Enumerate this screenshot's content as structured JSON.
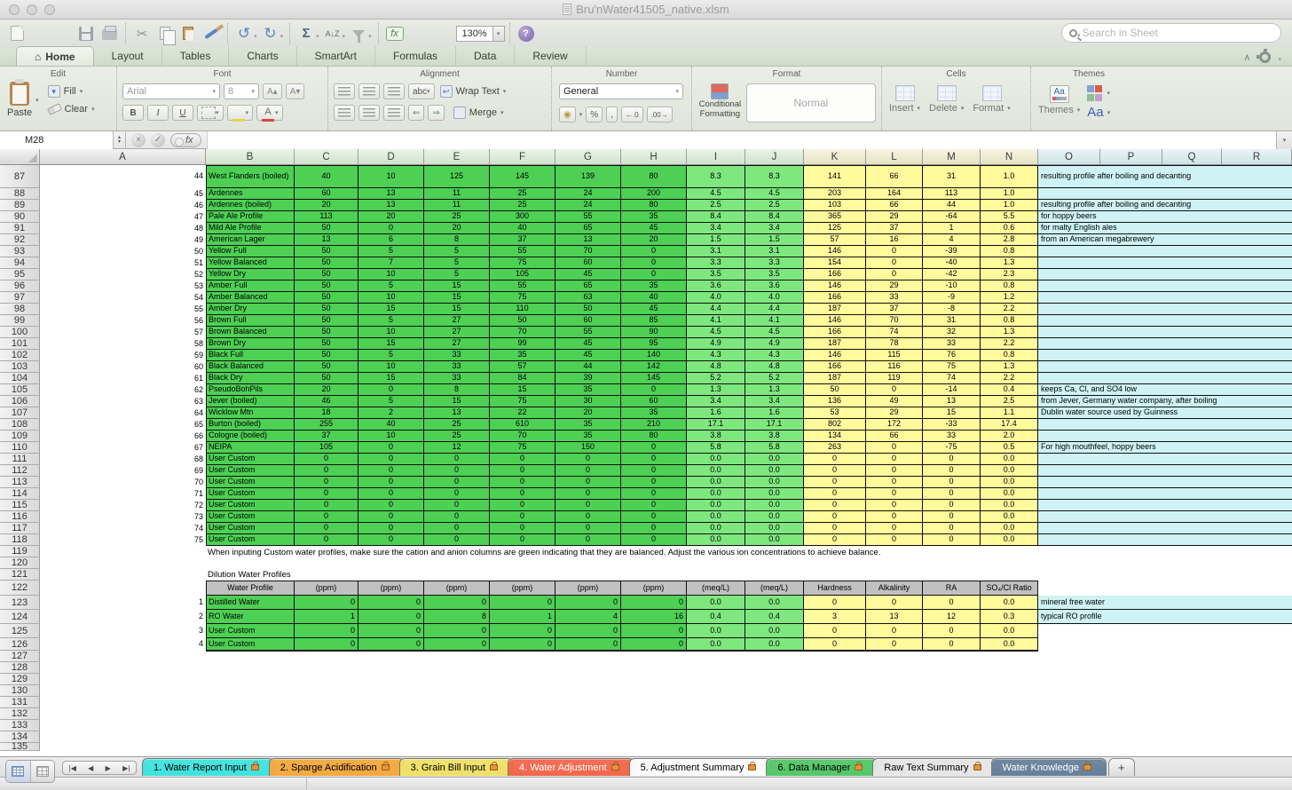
{
  "window": {
    "title": "Bru'nWater41505_native.xlsm"
  },
  "toolbar": {
    "zoom": "130%",
    "search_placeholder": "Search in Sheet",
    "icons": [
      "new-workbook",
      "open",
      "save",
      "print",
      "cut",
      "copy",
      "paste",
      "format-painter",
      "undo",
      "redo",
      "autosum",
      "sort",
      "filter",
      "insert-function",
      "gallery",
      "media-browser",
      "zoom",
      "help"
    ]
  },
  "icons": {
    "home": "⌂",
    "cut": "✂",
    "undo": "↺",
    "redo": "↻",
    "autosum": "Σ",
    "sort": "A↓Z",
    "fx": "fx",
    "percent": "%",
    "comma": ",",
    "dec_left": "←.0",
    "dec_right": ".00→",
    "collapse": "∧",
    "nav_first": "|◀",
    "nav_prev": "◀",
    "nav_next": "▶",
    "nav_last": "▶|",
    "cancel": "×",
    "accept": "✓",
    "stepper_up": "▴",
    "stepper_down": "▾",
    "dropdown": "▾",
    "help": "?",
    "abc": "abc",
    "aa": "Aa"
  },
  "ribbon_tabs": {
    "items": [
      "Home",
      "Layout",
      "Tables",
      "Charts",
      "SmartArt",
      "Formulas",
      "Data",
      "Review"
    ],
    "active": "Home"
  },
  "ribbon": {
    "groups": {
      "edit": "Edit",
      "font": "Font",
      "alignment": "Alignment",
      "number": "Number",
      "format": "Format",
      "cells": "Cells",
      "themes": "Themes"
    },
    "edit": {
      "paste": "Paste",
      "fill": "Fill",
      "clear": "Clear"
    },
    "font": {
      "name": "Arial",
      "size": "8",
      "bold": "B",
      "italic": "I",
      "underline": "U"
    },
    "alignment": {
      "abc": "abc",
      "wrap": "Wrap Text",
      "merge": "Merge"
    },
    "number": {
      "format": "General"
    },
    "format": {
      "conditional": "Conditional Formatting",
      "style": "Normal"
    },
    "cells": {
      "insert": "Insert",
      "delete": "Delete",
      "format": "Format"
    },
    "themes": {
      "themes": "Themes",
      "fonts": "Aa"
    }
  },
  "formula_bar": {
    "name_box": "M28",
    "fx": "fx",
    "value": ""
  },
  "grid": {
    "columns": [
      "A",
      "B",
      "C",
      "D",
      "E",
      "F",
      "G",
      "H",
      "I",
      "J",
      "K",
      "L",
      "M",
      "N",
      "O",
      "P",
      "Q",
      "R"
    ],
    "first_row": 87,
    "last_row": 135
  },
  "colors": {
    "ppm_green": "#4DD054",
    "meq_green": "#7EE87E",
    "stat_yellow": "#FFFA9B",
    "note_cyan": "#CFF2F4",
    "header_gray": "#C1C1C1"
  },
  "main_table": {
    "rows": [
      {
        "row": 87,
        "num": "44",
        "name": "West Flanders (boiled)",
        "ppm": [
          "40",
          "10",
          "125",
          "145",
          "139",
          "80"
        ],
        "meq": [
          "8.3",
          "8.3"
        ],
        "stats": [
          "141",
          "66",
          "31",
          "1.0"
        ],
        "note": "resulting profile after boiling and decanting"
      },
      {
        "row": 88,
        "num": "45",
        "name": "Ardennes",
        "ppm": [
          "60",
          "13",
          "11",
          "25",
          "24",
          "200"
        ],
        "meq": [
          "4.5",
          "4.5"
        ],
        "stats": [
          "203",
          "164",
          "113",
          "1.0"
        ],
        "note": ""
      },
      {
        "row": 89,
        "num": "46",
        "name": "Ardennes (boiled)",
        "ppm": [
          "20",
          "13",
          "11",
          "25",
          "24",
          "80"
        ],
        "meq": [
          "2.5",
          "2.5"
        ],
        "stats": [
          "103",
          "66",
          "44",
          "1.0"
        ],
        "note": "resulting profile after boiling and decanting"
      },
      {
        "row": 90,
        "num": "47",
        "name": "Pale Ale Profile",
        "ppm": [
          "113",
          "20",
          "25",
          "300",
          "55",
          "35"
        ],
        "meq": [
          "8.4",
          "8.4"
        ],
        "stats": [
          "365",
          "29",
          "-64",
          "5.5"
        ],
        "note": "for hoppy beers"
      },
      {
        "row": 91,
        "num": "48",
        "name": "Mild Ale Profile",
        "ppm": [
          "50",
          "0",
          "20",
          "40",
          "65",
          "45"
        ],
        "meq": [
          "3.4",
          "3.4"
        ],
        "stats": [
          "125",
          "37",
          "1",
          "0.6"
        ],
        "note": "for malty English ales"
      },
      {
        "row": 92,
        "num": "49",
        "name": "American Lager",
        "ppm": [
          "13",
          "6",
          "8",
          "37",
          "13",
          "20"
        ],
        "meq": [
          "1.5",
          "1.5"
        ],
        "stats": [
          "57",
          "16",
          "4",
          "2.8"
        ],
        "note": "from an American megabrewery"
      },
      {
        "row": 93,
        "num": "50",
        "name": "Yellow Full",
        "ppm": [
          "50",
          "5",
          "5",
          "55",
          "70",
          "0"
        ],
        "meq": [
          "3.1",
          "3.1"
        ],
        "stats": [
          "146",
          "0",
          "-39",
          "0.8"
        ],
        "note": ""
      },
      {
        "row": 94,
        "num": "51",
        "name": "Yellow Balanced",
        "ppm": [
          "50",
          "7",
          "5",
          "75",
          "60",
          "0"
        ],
        "meq": [
          "3.3",
          "3.3"
        ],
        "stats": [
          "154",
          "0",
          "-40",
          "1.3"
        ],
        "note": ""
      },
      {
        "row": 95,
        "num": "52",
        "name": "Yellow Dry",
        "ppm": [
          "50",
          "10",
          "5",
          "105",
          "45",
          "0"
        ],
        "meq": [
          "3.5",
          "3.5"
        ],
        "stats": [
          "166",
          "0",
          "-42",
          "2.3"
        ],
        "note": ""
      },
      {
        "row": 96,
        "num": "53",
        "name": "Amber Full",
        "ppm": [
          "50",
          "5",
          "15",
          "55",
          "65",
          "35"
        ],
        "meq": [
          "3.6",
          "3.6"
        ],
        "stats": [
          "146",
          "29",
          "-10",
          "0.8"
        ],
        "note": ""
      },
      {
        "row": 97,
        "num": "54",
        "name": "Amber Balanced",
        "ppm": [
          "50",
          "10",
          "15",
          "75",
          "63",
          "40"
        ],
        "meq": [
          "4.0",
          "4.0"
        ],
        "stats": [
          "166",
          "33",
          "-9",
          "1.2"
        ],
        "note": ""
      },
      {
        "row": 98,
        "num": "55",
        "name": "Amber Dry",
        "ppm": [
          "50",
          "15",
          "15",
          "110",
          "50",
          "45"
        ],
        "meq": [
          "4.4",
          "4.4"
        ],
        "stats": [
          "187",
          "37",
          "-8",
          "2.2"
        ],
        "note": ""
      },
      {
        "row": 99,
        "num": "56",
        "name": "Brown Full",
        "ppm": [
          "50",
          "5",
          "27",
          "50",
          "60",
          "85"
        ],
        "meq": [
          "4.1",
          "4.1"
        ],
        "stats": [
          "146",
          "70",
          "31",
          "0.8"
        ],
        "note": ""
      },
      {
        "row": 100,
        "num": "57",
        "name": "Brown Balanced",
        "ppm": [
          "50",
          "10",
          "27",
          "70",
          "55",
          "90"
        ],
        "meq": [
          "4.5",
          "4.5"
        ],
        "stats": [
          "166",
          "74",
          "32",
          "1.3"
        ],
        "note": ""
      },
      {
        "row": 101,
        "num": "58",
        "name": "Brown Dry",
        "ppm": [
          "50",
          "15",
          "27",
          "99",
          "45",
          "95"
        ],
        "meq": [
          "4.9",
          "4.9"
        ],
        "stats": [
          "187",
          "78",
          "33",
          "2.2"
        ],
        "note": ""
      },
      {
        "row": 102,
        "num": "59",
        "name": "Black Full",
        "ppm": [
          "50",
          "5",
          "33",
          "35",
          "45",
          "140"
        ],
        "meq": [
          "4.3",
          "4.3"
        ],
        "stats": [
          "146",
          "115",
          "76",
          "0.8"
        ],
        "note": ""
      },
      {
        "row": 103,
        "num": "60",
        "name": "Black Balanced",
        "ppm": [
          "50",
          "10",
          "33",
          "57",
          "44",
          "142"
        ],
        "meq": [
          "4.8",
          "4.8"
        ],
        "stats": [
          "166",
          "116",
          "75",
          "1.3"
        ],
        "note": ""
      },
      {
        "row": 104,
        "num": "61",
        "name": "Black Dry",
        "ppm": [
          "50",
          "15",
          "33",
          "84",
          "39",
          "145"
        ],
        "meq": [
          "5.2",
          "5.2"
        ],
        "stats": [
          "187",
          "119",
          "74",
          "2.2"
        ],
        "note": ""
      },
      {
        "row": 105,
        "num": "62",
        "name": "PseudoBohPils",
        "ppm": [
          "20",
          "0",
          "8",
          "15",
          "35",
          "0"
        ],
        "meq": [
          "1.3",
          "1.3"
        ],
        "stats": [
          "50",
          "0",
          "-14",
          "0.4"
        ],
        "note": "keeps Ca, Cl, and SO4 low"
      },
      {
        "row": 106,
        "num": "63",
        "name": "Jever (boiled)",
        "ppm": [
          "46",
          "5",
          "15",
          "75",
          "30",
          "60"
        ],
        "meq": [
          "3.4",
          "3.4"
        ],
        "stats": [
          "136",
          "49",
          "13",
          "2.5"
        ],
        "note": "from Jever, Germany water company, after boiling"
      },
      {
        "row": 107,
        "num": "64",
        "name": "Wicklow Mtn",
        "ppm": [
          "18",
          "2",
          "13",
          "22",
          "20",
          "35"
        ],
        "meq": [
          "1.6",
          "1.6"
        ],
        "stats": [
          "53",
          "29",
          "15",
          "1.1"
        ],
        "note": "Dublin water source used by Guinness"
      },
      {
        "row": 108,
        "num": "65",
        "name": "Burton (boiled)",
        "ppm": [
          "255",
          "40",
          "25",
          "610",
          "35",
          "210"
        ],
        "meq": [
          "17.1",
          "17.1"
        ],
        "stats": [
          "802",
          "172",
          "-33",
          "17.4"
        ],
        "note": ""
      },
      {
        "row": 109,
        "num": "66",
        "name": "Cologne (boiled)",
        "ppm": [
          "37",
          "10",
          "25",
          "70",
          "35",
          "80"
        ],
        "meq": [
          "3.8",
          "3.8"
        ],
        "stats": [
          "134",
          "66",
          "33",
          "2.0"
        ],
        "note": ""
      },
      {
        "row": 110,
        "num": "67",
        "name": "NEIPA",
        "ppm": [
          "105",
          "0",
          "12",
          "75",
          "150",
          "0"
        ],
        "meq": [
          "5.8",
          "5.8"
        ],
        "stats": [
          "263",
          "0",
          "-75",
          "0.5"
        ],
        "note": "For high mouthfeel, hoppy beers"
      },
      {
        "row": 111,
        "num": "68",
        "name": "User Custom",
        "ppm": [
          "0",
          "0",
          "0",
          "0",
          "0",
          "0"
        ],
        "meq": [
          "0.0",
          "0.0"
        ],
        "stats": [
          "0",
          "0",
          "0",
          "0.0"
        ],
        "note": ""
      },
      {
        "row": 112,
        "num": "69",
        "name": "User Custom",
        "ppm": [
          "0",
          "0",
          "0",
          "0",
          "0",
          "0"
        ],
        "meq": [
          "0.0",
          "0.0"
        ],
        "stats": [
          "0",
          "0",
          "0",
          "0.0"
        ],
        "note": ""
      },
      {
        "row": 113,
        "num": "70",
        "name": "User Custom",
        "ppm": [
          "0",
          "0",
          "0",
          "0",
          "0",
          "0"
        ],
        "meq": [
          "0.0",
          "0.0"
        ],
        "stats": [
          "0",
          "0",
          "0",
          "0.0"
        ],
        "note": ""
      },
      {
        "row": 114,
        "num": "71",
        "name": "User Custom",
        "ppm": [
          "0",
          "0",
          "0",
          "0",
          "0",
          "0"
        ],
        "meq": [
          "0.0",
          "0.0"
        ],
        "stats": [
          "0",
          "0",
          "0",
          "0.0"
        ],
        "note": ""
      },
      {
        "row": 115,
        "num": "72",
        "name": "User Custom",
        "ppm": [
          "0",
          "0",
          "0",
          "0",
          "0",
          "0"
        ],
        "meq": [
          "0.0",
          "0.0"
        ],
        "stats": [
          "0",
          "0",
          "0",
          "0.0"
        ],
        "note": ""
      },
      {
        "row": 116,
        "num": "73",
        "name": "User Custom",
        "ppm": [
          "0",
          "0",
          "0",
          "0",
          "0",
          "0"
        ],
        "meq": [
          "0.0",
          "0.0"
        ],
        "stats": [
          "0",
          "0",
          "0",
          "0.0"
        ],
        "note": ""
      },
      {
        "row": 117,
        "num": "74",
        "name": "User Custom",
        "ppm": [
          "0",
          "0",
          "0",
          "0",
          "0",
          "0"
        ],
        "meq": [
          "0.0",
          "0.0"
        ],
        "stats": [
          "0",
          "0",
          "0",
          "0.0"
        ],
        "note": ""
      },
      {
        "row": 118,
        "num": "75",
        "name": "User Custom",
        "ppm": [
          "0",
          "0",
          "0",
          "0",
          "0",
          "0"
        ],
        "meq": [
          "0.0",
          "0.0"
        ],
        "stats": [
          "0",
          "0",
          "0",
          "0.0"
        ],
        "note": ""
      }
    ]
  },
  "notes": {
    "custom_note": "When inputing Custom water profiles, make sure the cation and anion columns are green indicating that they are balanced.  Adjust the various ion concentrations to achieve balance."
  },
  "dilution": {
    "label": "Dilution Water Profiles",
    "header": {
      "profile": "Water Profile",
      "ppm": "(ppm)",
      "meq": "(meq/L)",
      "hardness": "Hardness",
      "alkalinity": "Alkalinity",
      "ra": "RA",
      "ratio": "SO₄/Cl Ratio"
    },
    "rows": [
      {
        "row": 123,
        "num": "1",
        "name": "Distilled Water",
        "ppm": [
          "0",
          "0",
          "0",
          "0",
          "0",
          "0"
        ],
        "meq": [
          "0.0",
          "0.0"
        ],
        "stats": [
          "0",
          "0",
          "0",
          "0.0"
        ],
        "note": "mineral free water"
      },
      {
        "row": 124,
        "num": "2",
        "name": "RO Water",
        "ppm": [
          "1",
          "0",
          "8",
          "1",
          "4",
          "16"
        ],
        "meq": [
          "0.4",
          "0.4"
        ],
        "stats": [
          "3",
          "13",
          "12",
          "0.3"
        ],
        "note": "typical RO profile"
      },
      {
        "row": 125,
        "num": "3",
        "name": "User Custom",
        "ppm": [
          "0",
          "0",
          "0",
          "0",
          "0",
          "0"
        ],
        "meq": [
          "0.0",
          "0.0"
        ],
        "stats": [
          "0",
          "0",
          "0",
          "0.0"
        ],
        "note": ""
      },
      {
        "row": 126,
        "num": "4",
        "name": "User Custom",
        "ppm": [
          "0",
          "0",
          "0",
          "0",
          "0",
          "0"
        ],
        "meq": [
          "0.0",
          "0.0"
        ],
        "stats": [
          "0",
          "0",
          "0",
          "0.0"
        ],
        "note": ""
      }
    ]
  },
  "sheet_tabs": {
    "items": [
      {
        "label": "1. Water Report Input",
        "color": "#3FE3DE",
        "text_color": "#000000",
        "locked": true
      },
      {
        "label": "2. Sparge Acidification",
        "color": "#F3A93E",
        "text_color": "#000000",
        "locked": true
      },
      {
        "label": "3. Grain Bill Input",
        "color": "#F0E068",
        "text_color": "#000000",
        "locked": true
      },
      {
        "label": "4. Water Adjustment",
        "color": "#F2674B",
        "text_color": "#FFFFFF",
        "locked": true
      },
      {
        "label": "5. Adjustment Summary",
        "color": "#FBFBFB",
        "text_color": "#000000",
        "locked": true
      },
      {
        "label": "6. Data Manager",
        "color": "#54C768",
        "text_color": "#000000",
        "locked": true
      },
      {
        "label": "Raw Text Summary",
        "color": "#E6E6E6",
        "text_color": "#000000",
        "locked": true
      },
      {
        "label": "Water Knowledge",
        "color": "#67809A",
        "text_color": "#FFFFFF",
        "locked": true
      }
    ],
    "add_label": "+"
  }
}
